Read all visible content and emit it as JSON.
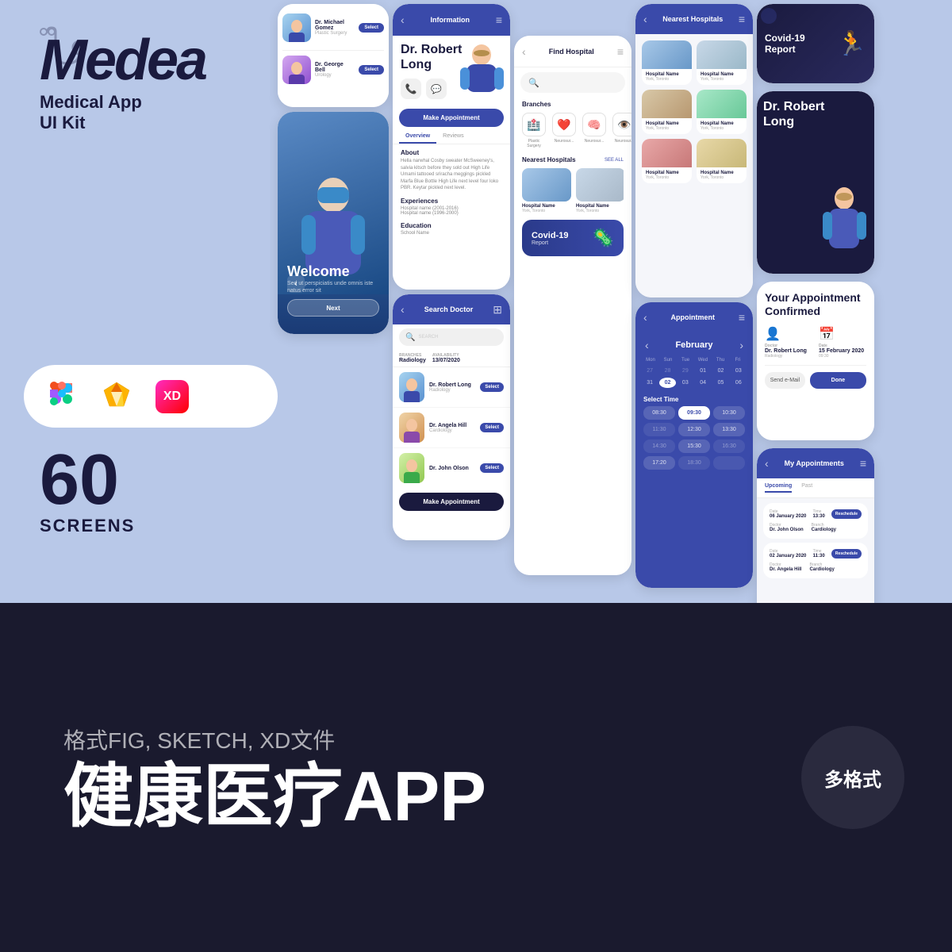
{
  "brand": {
    "title": "Medea",
    "subtitle_line1": "Medical App",
    "subtitle_line2": "UI Kit",
    "screens_count": "60",
    "screens_label": "SCREENS"
  },
  "tools": {
    "figma_label": "Figma",
    "sketch_label": "Sketch",
    "xd_label": "XD"
  },
  "bottom": {
    "format_text": "格式FIG, SKETCH, XD文件",
    "main_text": "健康医疗APP",
    "badge_text": "多格式"
  },
  "phones": {
    "phone1": {
      "welcome_text": "Welcome",
      "subtitle": "Sed ut perspiciatis unde omnis iste natus error sit"
    },
    "phone2": {
      "header_title": "Information",
      "doctor_name": "Dr. Robert Long",
      "tab_overview": "Overview",
      "tab_reviews": "Reviews",
      "about_title": "About",
      "about_text": "Hella narwhal Cosby sweater McSweeney's, salvia kitsch before they sold out High Life Umami tattooed sriracha meggings pickled Marfa Blue Bottle High Life next level four loko PBR. Keytar pickled next level.",
      "exp_title": "Experiences",
      "exp_line1": "Hospital name (2001-2016)",
      "exp_line2": "Hospital name (1996-2000)",
      "edu_title": "Education",
      "edu_value": "School Name",
      "make_appointment": "Make Appointment"
    },
    "phone3": {
      "header_title": "Find Hospital",
      "branches_title": "Branches",
      "nearest_hospitals": "Nearest Hospitals",
      "see_all": "SEE ALL",
      "hospital1": "Hospital Name",
      "hospital1_loc": "York, Toronto",
      "hospital2": "Hospital Name",
      "hospital2_loc": "York, Toronto",
      "covid_title": "Covid-19",
      "covid_sub": "Report"
    },
    "phone4": {
      "header_title": "Nearest Hospitals",
      "hospitals": [
        {
          "name": "Hospital Name",
          "loc": "York, Toronto"
        },
        {
          "name": "Hospital Name",
          "loc": "York, Toronto"
        },
        {
          "name": "Hospital Name",
          "loc": "York, Toronto"
        },
        {
          "name": "Hospital Name",
          "loc": "York, Toronto"
        },
        {
          "name": "Hospital Name",
          "loc": "York, Toronto"
        },
        {
          "name": "Hospital Name",
          "loc": "York, Toronto"
        }
      ]
    },
    "phone5": {
      "header_title": "Search Doctor",
      "search_placeholder": "SEARCH",
      "branch_label": "BRANCHES",
      "branch_value": "Radiology",
      "avail_label": "AVAILABILITY",
      "avail_value": "13/07/2020",
      "doctors": [
        {
          "name": "Dr. Robert Long",
          "spec": "Radiology"
        },
        {
          "name": "Dr. Angela Hill",
          "spec": "Cardiology"
        },
        {
          "name": "Dr. John Olson",
          "spec": ""
        }
      ],
      "make_appointment": "Make Appointment"
    },
    "phone6": {
      "header_title": "Appointment",
      "month": "February",
      "day_headers": [
        "Mon",
        "Sun",
        "Tue",
        "Wed",
        "Thu"
      ],
      "dates_row1": [
        "31",
        "01",
        "02",
        "03",
        "04"
      ],
      "time_slots": [
        "08:30",
        "09:30",
        "10:30",
        "11:30",
        "12:30",
        "13:30",
        "14:30",
        "15:30",
        "16:30",
        "17:20",
        "18:30",
        ""
      ],
      "selected_time": "09:30",
      "select_time_title": "Select Time"
    },
    "phone7": {
      "confirmation_title": "Your Appointment Confirmed",
      "doctor_label": "Doctor",
      "doctor_name": "Dr. Robert Long",
      "doctor_branch": "Radiology",
      "date_label": "Date",
      "date_value": "15 February 2020",
      "time_value": "09:30",
      "send_email": "Send e-Mail",
      "done": "Done",
      "covid_badge": "Covid-19 Report"
    },
    "phone8": {
      "header_title": "My Appointments",
      "tab_upcoming": "Upcoming",
      "tab_past": "Past",
      "appointments": [
        {
          "date_label": "Date",
          "date_value": "06 January 2020",
          "time_label": "Time",
          "time_value": "13:30",
          "doctor_label": "Doctor",
          "doctor_value": "Dr. John Olson",
          "branch_label": "Branch",
          "branch_value": "Cardiology"
        },
        {
          "date_label": "Date",
          "date_value": "02 January 2020",
          "time_label": "Time",
          "time_value": "11:30",
          "doctor_label": "Doctor",
          "doctor_value": "Dr. Angela Hill",
          "branch_label": "Branch",
          "branch_value": "Cardiology"
        }
      ]
    }
  },
  "top_phone_items": [
    {
      "doctor": "Dr. Michael Gomez",
      "spec": "Plastic Surgery"
    },
    {
      "doctor": "Dr. George Bell",
      "spec": "Urology"
    }
  ]
}
